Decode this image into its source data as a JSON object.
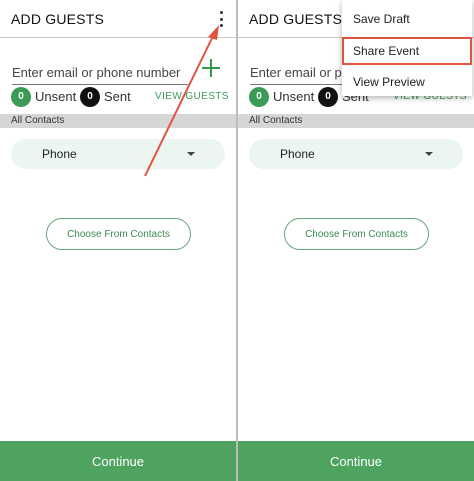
{
  "screens": [
    {
      "header": {
        "title": "ADD GUESTS"
      },
      "invite": {
        "placeholder": "Enter email or phone number"
      },
      "counts": {
        "unsent_count": "0",
        "unsent_label": "Unsent",
        "sent_count": "0",
        "sent_label": "Sent"
      },
      "view_guests": "VIEW GUESTS",
      "section_label": "All Contacts",
      "contact_method": {
        "selected": "Phone"
      },
      "choose_from_contacts": "Choose From Contacts",
      "continue": "Continue"
    },
    {
      "header": {
        "title": "ADD GUESTS"
      },
      "invite": {
        "placeholder": "Enter email or phone number"
      },
      "counts": {
        "unsent_count": "0",
        "unsent_label": "Unsent",
        "sent_count": "0",
        "sent_label": "Sent"
      },
      "view_guests": "VIEW GUESTS",
      "section_label": "All Contacts",
      "contact_method": {
        "selected": "Phone"
      },
      "choose_from_contacts": "Choose From Contacts",
      "continue": "Continue",
      "overflow_menu": {
        "items": [
          "Save Draft",
          "Share Event",
          "View Preview"
        ],
        "highlighted": "Share Event"
      }
    }
  ],
  "colors": {
    "accent_green": "#4ea35f",
    "light_green": "#eaf6ef",
    "annotation_red": "#e0533f"
  },
  "icons": {
    "overflow": "kebab-menu-icon",
    "add": "plus-icon",
    "select": "caret-down-icon"
  }
}
